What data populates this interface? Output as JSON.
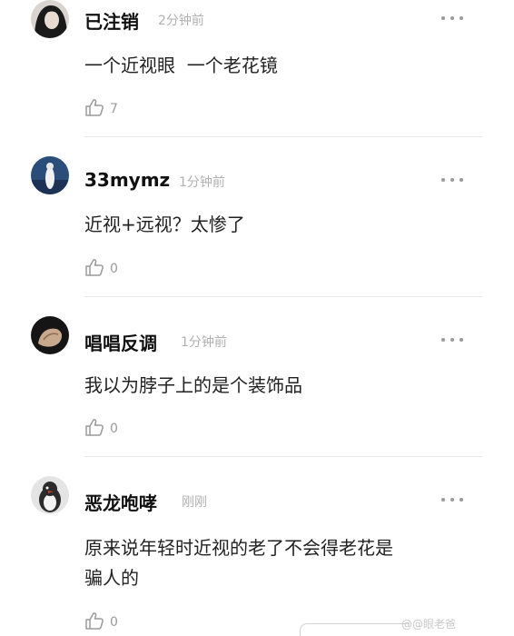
{
  "comments": [
    {
      "username": "已注销",
      "time": "2分钟前",
      "content": "一个近视眼  一个老花镜",
      "likes": "7",
      "avatar_icon": "avatar-dark-hair-icon"
    },
    {
      "username": "33mymz",
      "time": "1分钟前",
      "content": "近视+远视？太惨了",
      "likes": "0",
      "avatar_icon": "avatar-blue-scene-icon"
    },
    {
      "username": "唱唱反调",
      "time": "1分钟前",
      "content": "我以为脖子上的是个装饰品",
      "likes": "0",
      "avatar_icon": "avatar-hand-icon"
    },
    {
      "username": "恶龙咆哮",
      "time": "刚刚",
      "content_line1": "原来说年轻时近视的老了不会得老花是",
      "content_line2": "骗人的",
      "likes": "0",
      "avatar_icon": "avatar-penguin-icon"
    }
  ],
  "watermark": "@@眼老爸",
  "icons": {
    "more": "more-dots-icon",
    "like": "thumb-up-icon"
  },
  "colors": {
    "time": "#b0b0b0",
    "divider": "#e8e8e8",
    "like": "#9a9a9a"
  }
}
